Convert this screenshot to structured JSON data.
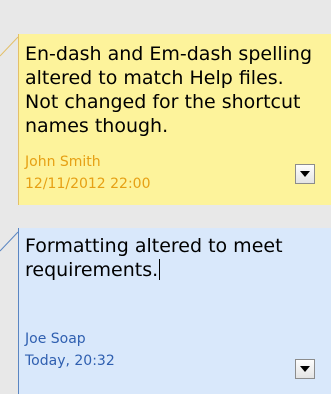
{
  "comments": [
    {
      "text": "En-dash and Em-dash spelling\naltered to match Help files.\nNot changed for the shortcut\nnames though.",
      "author": "John Smith",
      "timestamp": "12/11/2012 22:00",
      "bg_color": "#fdf39b",
      "meta_color": "#e6a014"
    },
    {
      "text": "Formatting altered to meet\nrequirements.",
      "author": "Joe Soap",
      "timestamp": "Today, 20:32",
      "bg_color": "#d9e8fb",
      "meta_color": "#2f5fb0",
      "editing": true
    }
  ],
  "icons": {
    "menu": "chevron-down-icon"
  }
}
